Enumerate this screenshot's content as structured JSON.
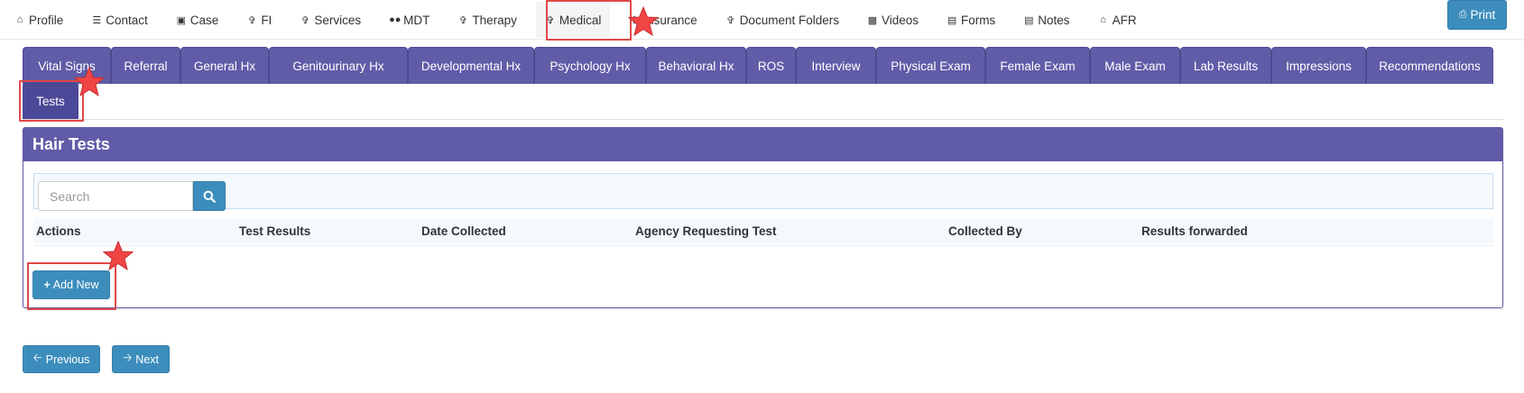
{
  "topnav": {
    "items": [
      {
        "label": "Profile",
        "icon": "home-icon"
      },
      {
        "label": "Contact",
        "icon": "list-icon"
      },
      {
        "label": "Case",
        "icon": "briefcase-icon"
      },
      {
        "label": "FI",
        "icon": "person-icon"
      },
      {
        "label": "Services",
        "icon": "person-icon"
      },
      {
        "label": "MDT",
        "icon": "users-icon"
      },
      {
        "label": "Therapy",
        "icon": "person-icon"
      },
      {
        "label": "Medical",
        "icon": "person-icon",
        "active": true
      },
      {
        "label": "Insurance",
        "icon": "person-icon"
      },
      {
        "label": "Document Folders",
        "icon": "person-icon"
      },
      {
        "label": "Videos",
        "icon": "file-video-icon"
      },
      {
        "label": "Forms",
        "icon": "file-text-icon"
      },
      {
        "label": "Notes",
        "icon": "file-text-icon"
      },
      {
        "label": "AFR",
        "icon": "home-icon"
      }
    ],
    "print_label": "Print"
  },
  "tabs": [
    {
      "label": "Vital Signs"
    },
    {
      "label": "Referral"
    },
    {
      "label": "General Hx"
    },
    {
      "label": "Genitourinary Hx"
    },
    {
      "label": "Developmental Hx"
    },
    {
      "label": "Psychology Hx"
    },
    {
      "label": "Behavioral Hx"
    },
    {
      "label": "ROS"
    },
    {
      "label": "Interview"
    },
    {
      "label": "Physical Exam"
    },
    {
      "label": "Female Exam"
    },
    {
      "label": "Male Exam"
    },
    {
      "label": "Lab Results"
    },
    {
      "label": "Impressions"
    },
    {
      "label": "Recommendations"
    },
    {
      "label": "Tests",
      "active": true
    }
  ],
  "panel": {
    "title": "Hair Tests",
    "search_placeholder": "Search",
    "columns": [
      "Actions",
      "Test Results",
      "Date Collected",
      "Agency Requesting Test",
      "Collected By",
      "Results forwarded"
    ],
    "add_label": "Add New"
  },
  "pager": {
    "previous_label": "Previous",
    "next_label": "Next"
  },
  "colors": {
    "accent_purple": "#605ca8",
    "button_blue": "#3c8dbc",
    "highlight_red": "#e04848"
  }
}
